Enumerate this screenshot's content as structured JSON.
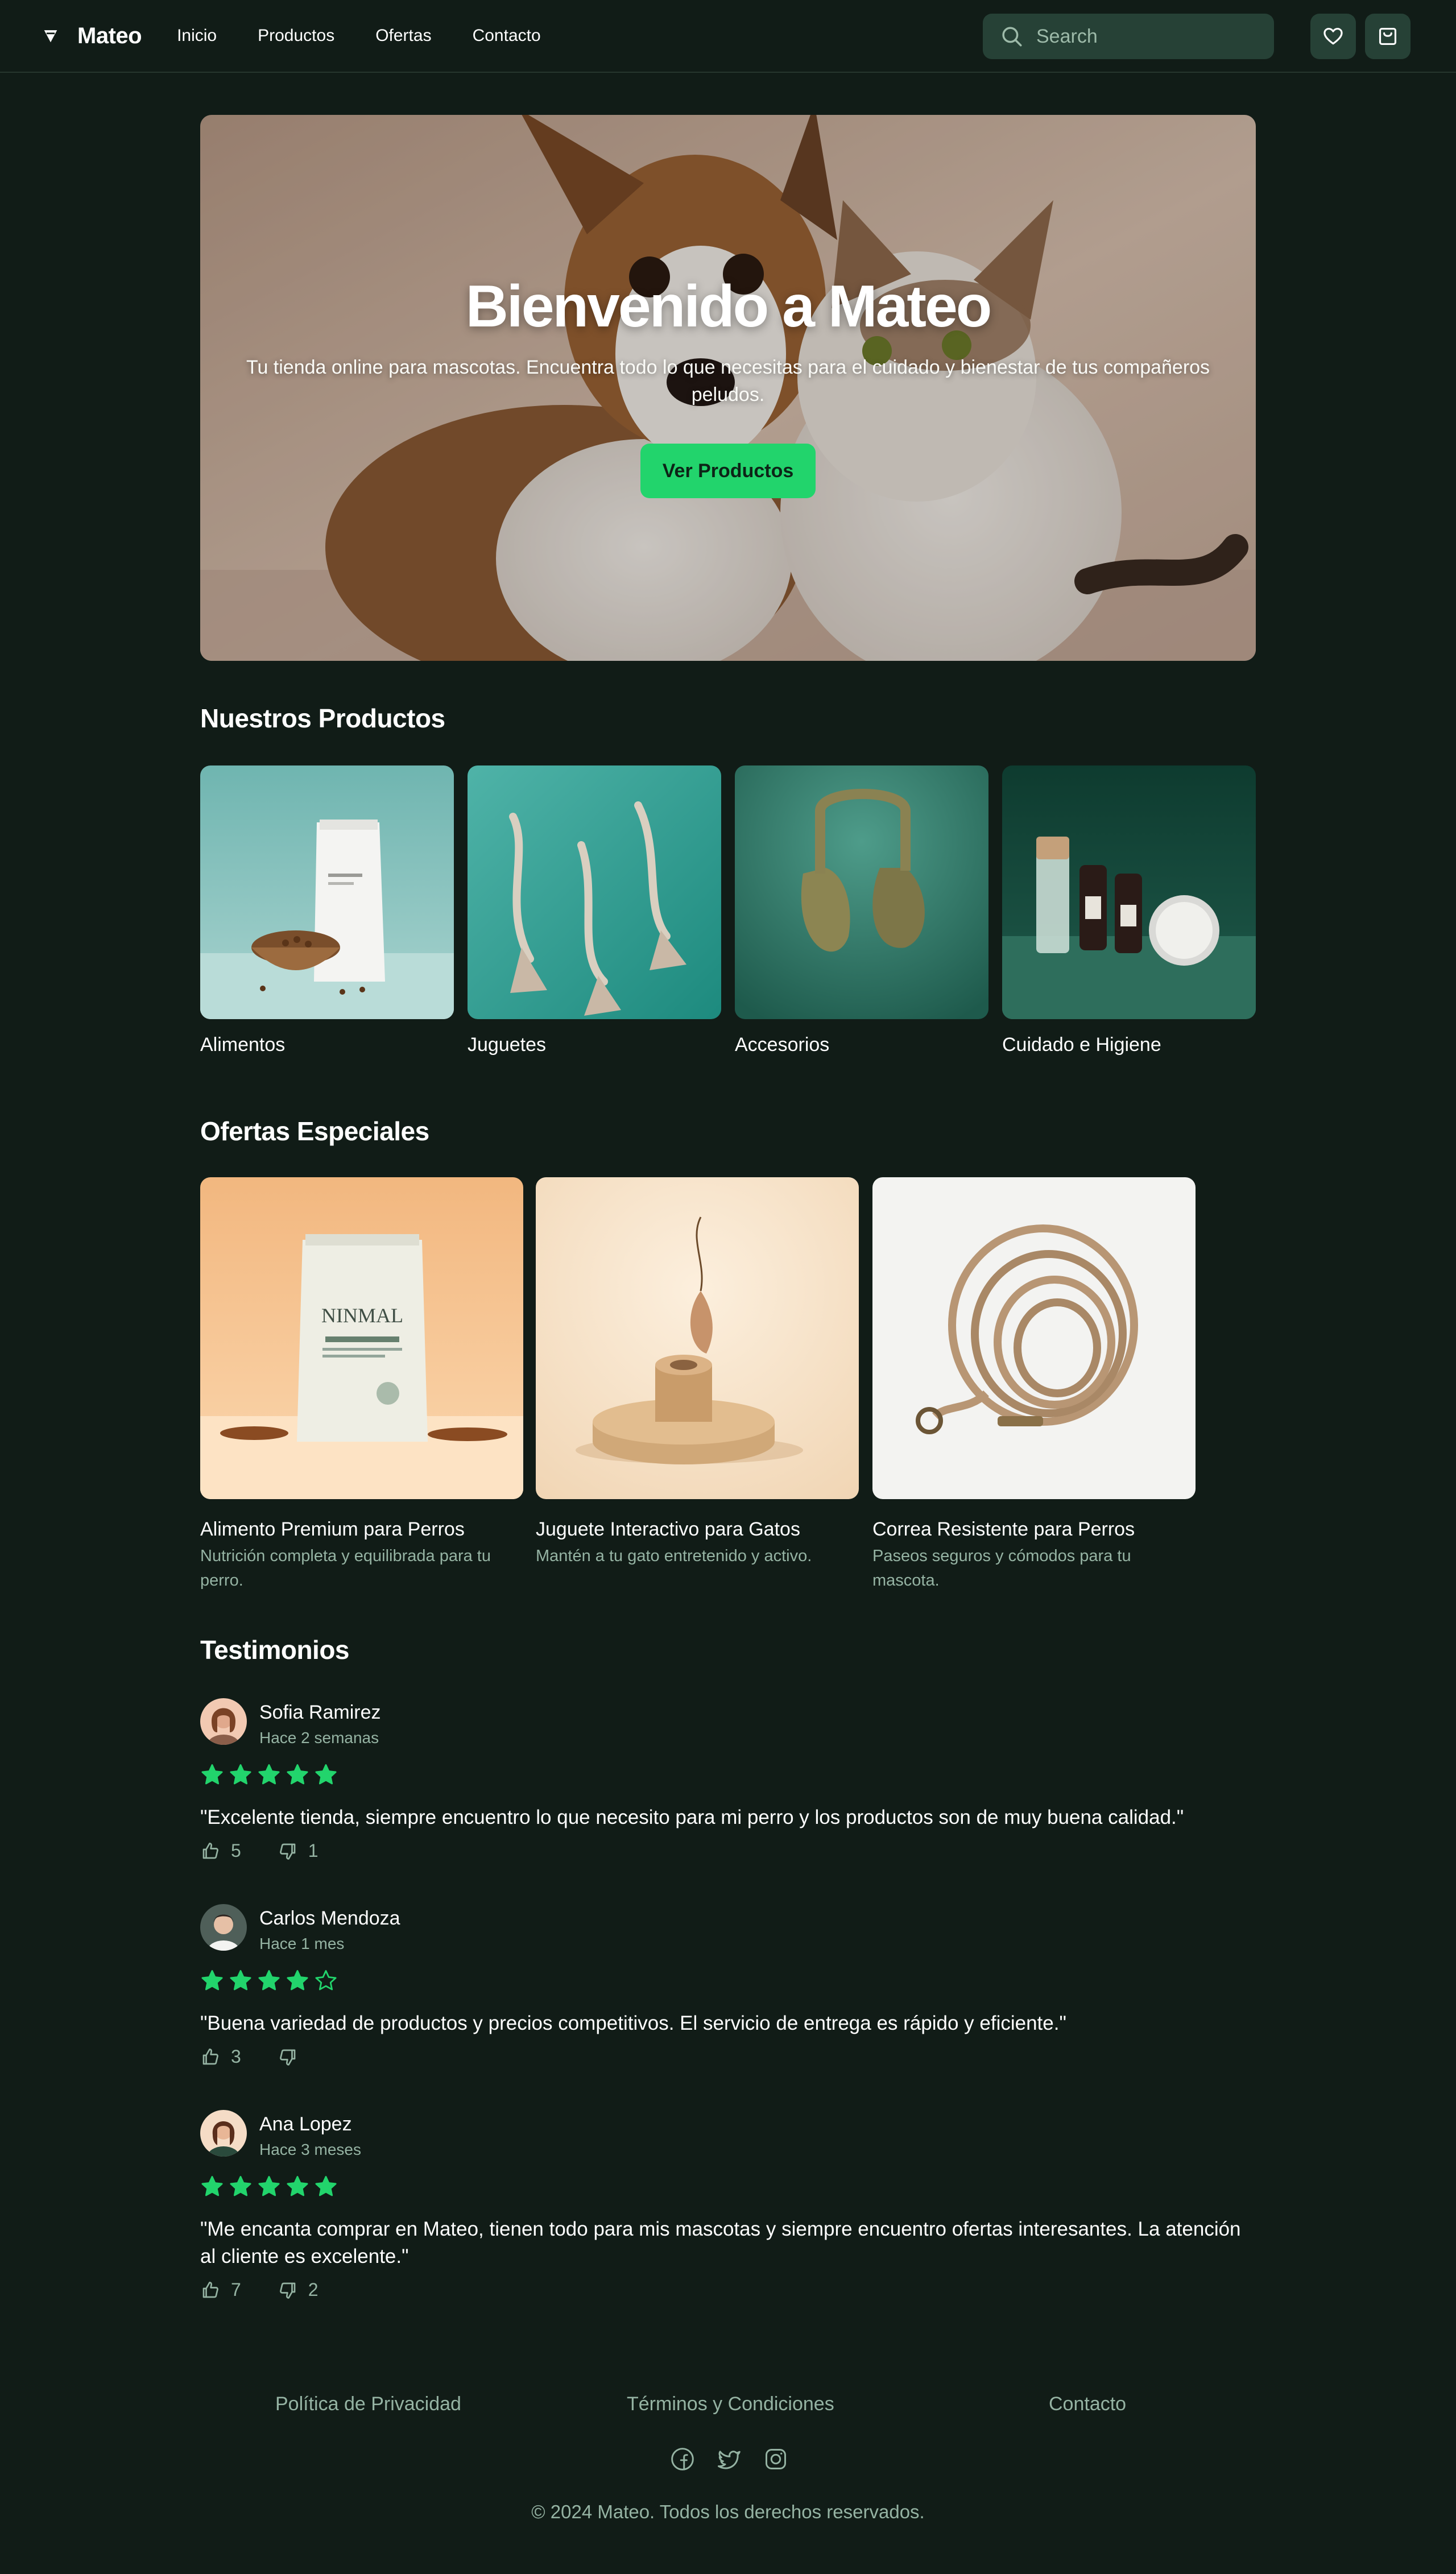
{
  "header": {
    "brand": "Mateo",
    "nav": [
      "Inicio",
      "Productos",
      "Ofertas",
      "Contacto"
    ],
    "search_placeholder": "Search"
  },
  "hero": {
    "title": "Bienvenido a Mateo",
    "subtitle": "Tu tienda online para mascotas. Encuentra todo lo que necesitas para el cuidado y bienestar de tus compañeros peludos.",
    "button": "Ver Productos"
  },
  "products": {
    "title": "Nuestros Productos",
    "categories": [
      "Alimentos",
      "Juguetes",
      "Accesorios",
      "Cuidado e Higiene"
    ]
  },
  "offers": {
    "title": "Ofertas Especiales",
    "items": [
      {
        "name": "Alimento Premium para Perros",
        "desc": "Nutrición completa y equilibrada para tu perro.",
        "package_text": "NINMAL"
      },
      {
        "name": "Juguete Interactivo para Gatos",
        "desc": "Mantén a tu gato entretenido y activo."
      },
      {
        "name": "Correa Resistente para Perros",
        "desc": "Paseos seguros y cómodos para tu mascota."
      }
    ]
  },
  "testimonials": {
    "title": "Testimonios",
    "reviews": [
      {
        "name": "Sofia Ramirez",
        "time": "Hace 2 semanas",
        "rating": 5,
        "text": "\"Excelente tienda, siempre encuentro lo que necesito para mi perro y los productos son de muy buena calidad.\"",
        "likes": "5",
        "dislikes": "1"
      },
      {
        "name": "Carlos Mendoza",
        "time": "Hace 1 mes",
        "rating": 4,
        "text": "\"Buena variedad de productos y precios competitivos. El servicio de entrega es rápido y eficiente.\"",
        "likes": "3",
        "dislikes": ""
      },
      {
        "name": "Ana Lopez",
        "time": "Hace 3 meses",
        "rating": 5,
        "text": "\"Me encanta comprar en Mateo, tienen todo para mis mascotas y siempre encuentro ofertas interesantes. La atención al cliente es excelente.\"",
        "likes": "7",
        "dislikes": "2"
      }
    ]
  },
  "footer": {
    "links": [
      "Política de Privacidad",
      "Términos y Condiciones",
      "Contacto"
    ],
    "social": [
      "facebook-icon",
      "twitter-icon",
      "instagram-icon"
    ],
    "copyright": "© 2024 Mateo. Todos los derechos reservados."
  },
  "colors": {
    "background": "#111c17",
    "accent": "#22d46c",
    "muted_text": "#95b3a3",
    "control_bg": "#264136"
  }
}
